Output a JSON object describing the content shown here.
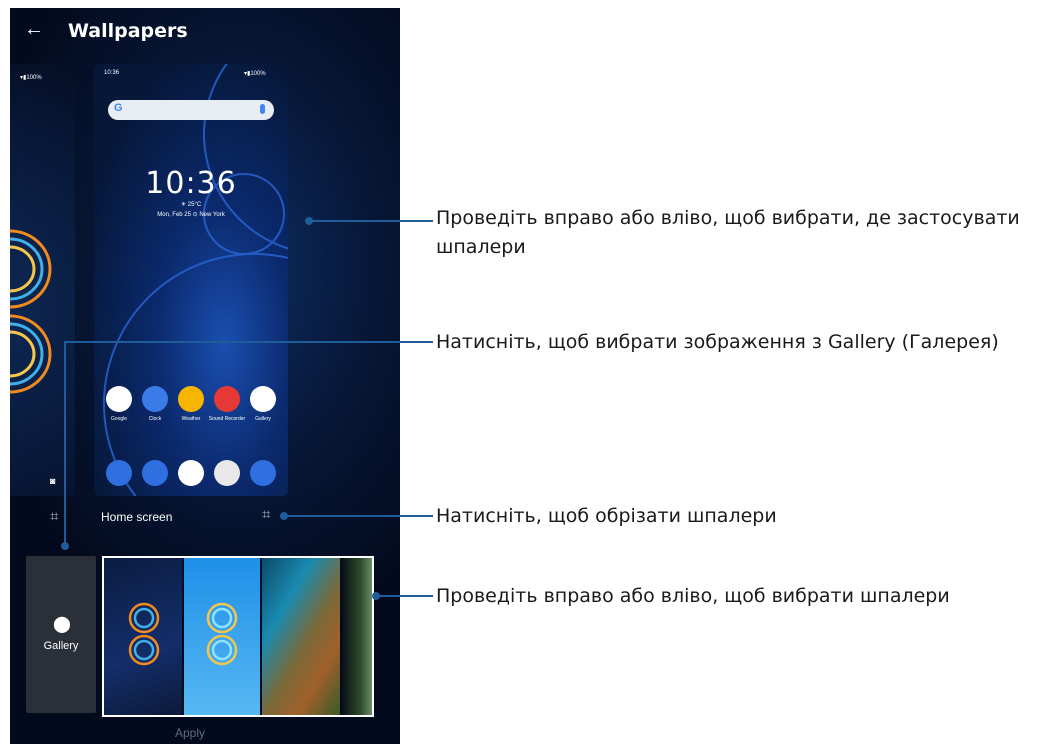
{
  "header": {
    "back_icon": "back-arrow-icon",
    "title": "Wallpapers"
  },
  "lock_preview": {
    "status": "▾▮100%"
  },
  "home_preview": {
    "status_time": "10:36",
    "status_icons": "▾▮100%",
    "clock": "10:36",
    "weather": "☀ 25°C",
    "date": "Mon, Feb 25  ⊙ New York",
    "apps": [
      {
        "label": "Google",
        "color": "#ffffff"
      },
      {
        "label": "Clock",
        "color": "#3b7be8"
      },
      {
        "label": "Weather",
        "color": "#f7b500"
      },
      {
        "label": "Sound Recorder",
        "color": "#e53935"
      },
      {
        "label": "Gallery",
        "color": "#ffffff"
      }
    ],
    "dock": [
      {
        "name": "phone-icon",
        "color": "#2f6fe0"
      },
      {
        "name": "messages-icon",
        "color": "#2f6fe0"
      },
      {
        "name": "play-store-icon",
        "color": "#ffffff"
      },
      {
        "name": "chrome-icon",
        "color": "#e8e8e8"
      },
      {
        "name": "camera-icon",
        "color": "#2f6fe0"
      }
    ],
    "label": "Home screen"
  },
  "gallery": {
    "label": "Gallery"
  },
  "apply_label": "Apply",
  "callouts": {
    "swipe_where": "Проведіть вправо або вліво, щоб вибрати, де застосувати шпалери",
    "gallery": "Натисніть, щоб вибрати зображення з Gallery (Галерея)",
    "crop": "Натисніть, щоб обрізати шпалери",
    "swipe_wallpaper": "Проведіть вправо або вліво, щоб вибрати шпалери"
  },
  "colors": {
    "accent": "#1f5d9a"
  }
}
